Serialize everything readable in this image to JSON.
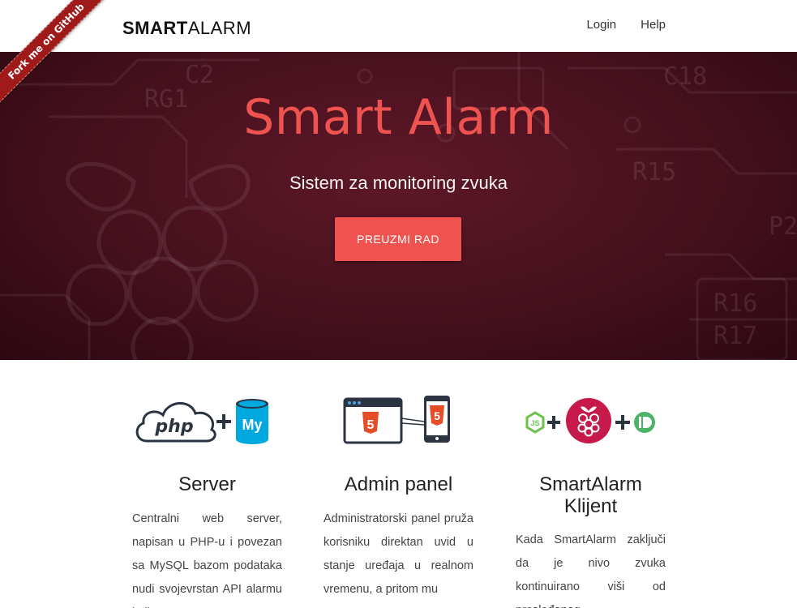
{
  "header": {
    "brand_bold": "SMART",
    "brand_light": "ALARM",
    "nav": [
      {
        "label": "Login"
      },
      {
        "label": "Help"
      }
    ]
  },
  "ribbon": {
    "label": "Fork me on GitHub"
  },
  "hero": {
    "title": "Smart Alarm",
    "subtitle": "Sistem za monitoring zvuka",
    "button": "PREUZMI RAD",
    "background_labels": [
      "RG1",
      "R15",
      "R16",
      "R17",
      "C18",
      "C2",
      "P2"
    ]
  },
  "features": [
    {
      "title": "Server",
      "icons": [
        "php-icon",
        "mysql-icon"
      ],
      "icon_text": {
        "php": "php",
        "mysql": "My"
      },
      "text": "Centralni web server, napisan u PHP-u i povezan sa MySQL bazom podataka nudi svojevrstan API alarmu koji"
    },
    {
      "title": "Admin panel",
      "icons": [
        "html5-browser-icon",
        "html5-phone-icon"
      ],
      "icon_text": {
        "html5": "5"
      },
      "text": "Administratorski panel pruža korisniku direktan uvid u stanje uređaja u realnom vremenu, a pritom mu"
    },
    {
      "title": "SmartAlarm Klijent",
      "icons": [
        "nodejs-icon",
        "raspberry-pi-icon",
        "pushbullet-icon"
      ],
      "icon_text": {
        "nodejs": "JS"
      },
      "text": "Kada SmartAlarm zaključi da je nivo zvuka kontinuirano viši od prosleđenog"
    }
  ],
  "colors": {
    "accent": "#ee5350",
    "hero_dark": "#46101d",
    "ribbon": "#a01a1a",
    "node_green": "#6cc24a",
    "raspberry": "#c51a4a",
    "pushbullet": "#4ab367",
    "mysql_blue": "#00a8e0",
    "html5_orange": "#e44d26"
  }
}
